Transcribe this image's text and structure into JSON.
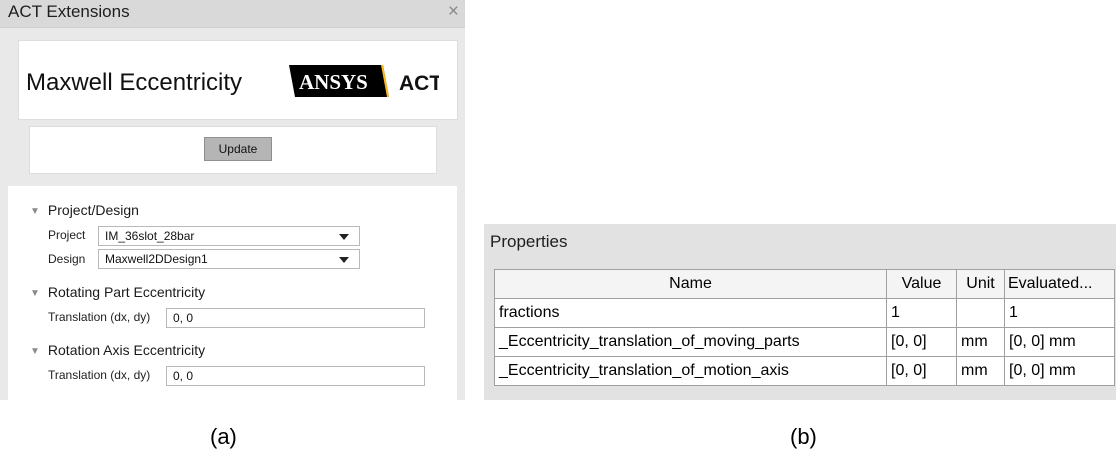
{
  "panel_a": {
    "window_title": "ACT Extensions",
    "close_glyph": "×",
    "extension_title": "Maxwell Eccentricity",
    "logo": {
      "brand": "ANSYS",
      "suffix": "ACT",
      "name": "ansys-act-logo"
    },
    "update_label": "Update",
    "sections": [
      {
        "title": "Project/Design",
        "fields": [
          {
            "label": "Project",
            "value": "IM_36slot_28bar",
            "type": "select"
          },
          {
            "label": "Design",
            "value": "Maxwell2DDesign1",
            "type": "select"
          }
        ]
      },
      {
        "title": "Rotating Part Eccentricity",
        "fields": [
          {
            "label": "Translation (dx, dy)",
            "value": "0, 0",
            "type": "text"
          }
        ]
      },
      {
        "title": "Rotation Axis Eccentricity",
        "fields": [
          {
            "label": "Translation (dx, dy)",
            "value": "0, 0",
            "type": "text"
          }
        ]
      }
    ],
    "caption": "(a)"
  },
  "panel_b": {
    "title": "Properties",
    "columns": [
      "Name",
      "Value",
      "Unit",
      "Evaluated..."
    ],
    "rows": [
      [
        "fractions",
        "1",
        "",
        "1"
      ],
      [
        "_Eccentricity_translation_of_moving_parts",
        "[0, 0]",
        "mm",
        "[0, 0] mm"
      ],
      [
        "_Eccentricity_translation_of_motion_axis",
        "[0, 0]",
        "mm",
        "[0, 0] mm"
      ]
    ],
    "caption": "(b)"
  },
  "colors": {
    "panel_bg": "#e9e9e9",
    "titlebar_bg": "#d9d9d9",
    "button_bg": "#b5b5b5",
    "logo_black": "#000000",
    "logo_yellow": "#ffb71b"
  }
}
